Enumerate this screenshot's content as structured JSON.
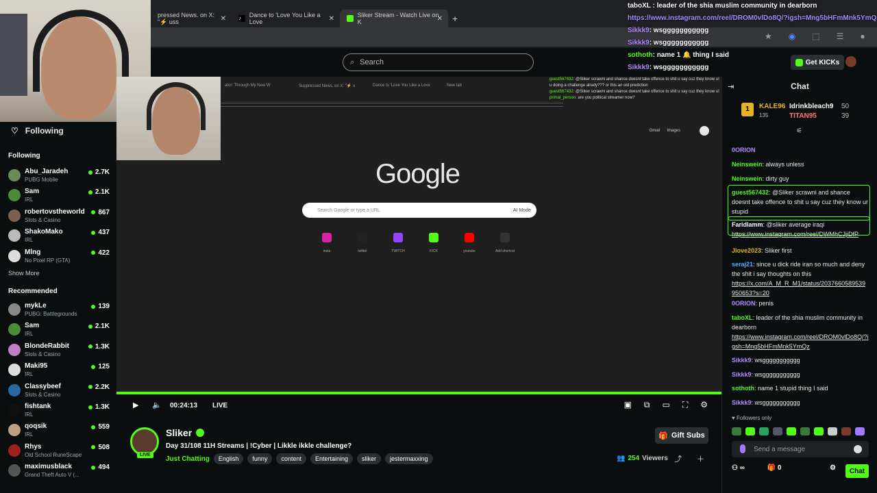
{
  "browser": {
    "tabs": [
      {
        "label": "pressed News. on X: \"⚡️ uss"
      },
      {
        "label": "Dance to 'Love You Like a Love"
      },
      {
        "label": "Sliker Stream - Watch Live on K"
      }
    ],
    "new_tab": "+"
  },
  "overlay_chat": [
    {
      "user": "tabo",
      "text": "XL : leader of the shia muslim community in dearborn"
    },
    {
      "user": "",
      "text": "https://www.instagram.com/reel/DROM0vlDo8Q/?igsh=Mng5bHFmMnk5YmQz"
    },
    {
      "user": "Sikkk9",
      "text": ": wsggggggggggg"
    },
    {
      "user": "Sikkk9",
      "text": ": wsggggggggggg"
    },
    {
      "user": "sothoth",
      "text": ": name 1 🔔 thing I said"
    },
    {
      "user": "Sikkk9",
      "text": ": wsggggggggggg"
    }
  ],
  "header": {
    "search_placeholder": "Search",
    "get_kicks": "Get KICKs"
  },
  "sidebar": {
    "following_title": "Following",
    "following_section": "Following",
    "following": [
      {
        "name": "Abu_Jaradeh",
        "category": "PUBG Mobile",
        "viewers": "2.7K",
        "color": "#6b8a5a"
      },
      {
        "name": "Sam",
        "category": "IRL",
        "viewers": "2.1K",
        "color": "#4a8c3a"
      },
      {
        "name": "robertovstheworld",
        "category": "Slots & Casino",
        "viewers": "867",
        "color": "#7a6050"
      },
      {
        "name": "ShakoMako",
        "category": "IRL",
        "viewers": "437",
        "color": "#bbb"
      },
      {
        "name": "Mlng",
        "category": "No Pixel RP (GTA)",
        "viewers": "422",
        "color": "#ddd"
      }
    ],
    "show_more": "Show More",
    "recommended_section": "Recommended",
    "recommended": [
      {
        "name": "mykLe",
        "category": "PUBG: Battlegrounds",
        "viewers": "139",
        "color": "#888"
      },
      {
        "name": "Sam",
        "category": "IRL",
        "viewers": "2.1K",
        "color": "#4a8c3a"
      },
      {
        "name": "BlondeRabbit",
        "category": "Slots & Casino",
        "viewers": "1.3K",
        "color": "#c080c0"
      },
      {
        "name": "Maki95",
        "category": "IRL",
        "viewers": "125",
        "color": "#ddd"
      },
      {
        "name": "Classybeef",
        "category": "Slots & Casino",
        "viewers": "2.2K",
        "color": "#2a6aa0"
      },
      {
        "name": "fishtank",
        "category": "IRL",
        "viewers": "1.3K",
        "color": "#111"
      },
      {
        "name": "qoqsik",
        "category": "IRL",
        "viewers": "559",
        "color": "#c0a080"
      },
      {
        "name": "Rhys",
        "category": "Old School RuneScape",
        "viewers": "508",
        "color": "#a02020"
      },
      {
        "name": "maximusblack",
        "category": "Grand Theft Auto V (...",
        "viewers": "494",
        "color": "#555"
      }
    ]
  },
  "video": {
    "inner_tabs": [
      "ator: Through My New W",
      "Suppressed News. on X: \"⚡ u",
      "Dance to 'Love You Like a Love",
      "New tab"
    ],
    "inner_chat": [
      {
        "user": "guest567432",
        "text": ": @Sliker scrawni and shance doesnt take offence to shit u say cuz they know u!"
      },
      {
        "user": "",
        "text": "u doing a challenge alrady??? or this an old prediction"
      },
      {
        "user": "guest567432",
        "text": ": @Sliker scrawni and shance doesnt take offence to shit u say cuz they know u!"
      },
      {
        "user": "primal_person",
        "text": ": are you political streamer now?"
      }
    ],
    "gmail": "Gmail",
    "images": "Images",
    "google": "Google",
    "google_search": "Search Google or type a URL",
    "ai_mode": "AI Mode",
    "shortcuts": [
      {
        "label": "insta",
        "color": "#d6249f"
      },
      {
        "label": "twitter",
        "color": "#222"
      },
      {
        "label": "TWITCH",
        "color": "#9146ff"
      },
      {
        "label": "KICK",
        "color": "#53fc18"
      },
      {
        "label": "youtube",
        "color": "#ff0000"
      },
      {
        "label": "Add shortcut",
        "color": "#333"
      }
    ],
    "customize": "Customize Chrome"
  },
  "player": {
    "time": "00:24:13",
    "live": "LIVE"
  },
  "stream": {
    "name": "Sliker",
    "live_badge": "LIVE",
    "title": "Day 31/108 11H Streams | !Cyber | Likkle ikkle challenge?",
    "category": "Just Chatting",
    "tags": [
      "English",
      "funny",
      "content",
      "Entertaining",
      "sliker",
      "jestermaxxing"
    ],
    "gift_subs": "Gift Subs",
    "viewers": "254",
    "viewers_label": "Viewers"
  },
  "chat": {
    "title": "Chat",
    "leaderboard": {
      "rank": "1",
      "first_name": "KALE96",
      "first_count": "135",
      "second_name": "Idrinkbleach9",
      "second_count": "50",
      "third_name": "TITAN95",
      "third_count": "39"
    },
    "messages": [
      {
        "user": "0ORION",
        "text": "",
        "color": "#b58bff"
      },
      {
        "user": "Neinswein",
        "text": ": always unless",
        "color": "#53fc18"
      },
      {
        "user": "Neinswein",
        "text": ": dirty guy",
        "color": "#53fc18"
      },
      {
        "user": "guest567432",
        "text": ": @Sliker scrawni and shance doesnt take offence to shit u say cuz they know ur stupid",
        "color": "#53fc18"
      },
      {
        "user": "Faridlamm",
        "text": ": @sliker average iraqi",
        "color": "#fff",
        "link": "https://www.instagram.com/reel/DWMhCJjiDfP"
      },
      {
        "user": "Jlove2023",
        "text": ": Sliker first",
        "color": "#e6b325"
      },
      {
        "user": "seraj21",
        "text": ": since u dick ride iran so much and deny the shit i say thoughts on this",
        "color": "#53b0ff",
        "link": "https://x.com/A_M_R_M1/status/2037660589539950653?s=20"
      },
      {
        "user": "0ORION",
        "text": ": penis",
        "color": "#b58bff"
      },
      {
        "user": "taboXL",
        "text": ": leader of the shia muslim community in dearborn",
        "color": "#53fc18",
        "link": "https://www.instagram.com/reel/DROM0vlDo8Q/?igsh=Mng5bHFmMnk5YmQz"
      },
      {
        "user": "Sikkk9",
        "text": ": wsggggggggggg",
        "color": "#b58bff"
      },
      {
        "user": "Sikkk9",
        "text": ": wsggggggggggg",
        "color": "#b58bff"
      },
      {
        "user": "sothoth",
        "text": ": name 1 stupid thing I said",
        "color": "#53fc18"
      },
      {
        "user": "Sikkk9",
        "text": ": wsggggggggggg",
        "color": "#b58bff"
      }
    ],
    "followers_only": "Followers only",
    "send_placeholder": "Send a message",
    "footer_count": "0",
    "chat_button": "Chat"
  }
}
